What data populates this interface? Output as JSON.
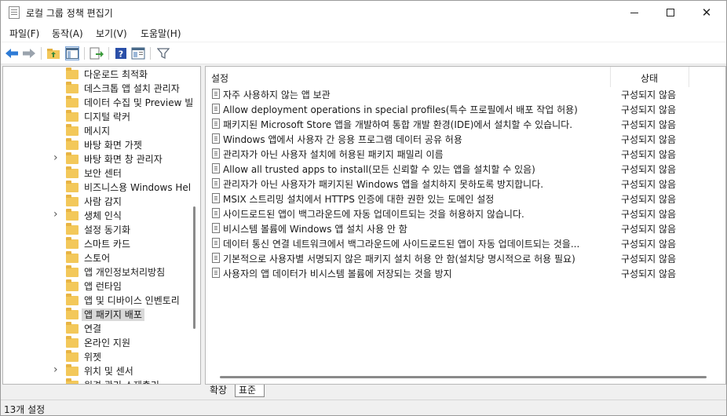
{
  "window": {
    "title": "로컬 그룹 정책 편집기",
    "controls": [
      "minimize",
      "maximize",
      "close"
    ]
  },
  "menu": [
    {
      "label": "파일(F)"
    },
    {
      "label": "동작(A)"
    },
    {
      "label": "보기(V)"
    },
    {
      "label": "도움말(H)"
    }
  ],
  "toolbar": {
    "icons": [
      "back-arrow-icon",
      "forward-arrow-icon",
      "up-folder-icon",
      "show-hide-tree-icon",
      "export-list-icon",
      "help-icon",
      "properties-icon",
      "filter-icon"
    ],
    "colors": {
      "arrows": "#2e7bd6",
      "help": "#2a4fa8",
      "filter": "#5f6b7a"
    }
  },
  "tree": {
    "items": [
      {
        "label": "다운로드 최적화",
        "expandable": false
      },
      {
        "label": "데스크톱 앱 설치 관리자",
        "expandable": false
      },
      {
        "label": "데이터 수집 및 Preview 빌",
        "expandable": false
      },
      {
        "label": "디지털 락커",
        "expandable": false
      },
      {
        "label": "메시지",
        "expandable": false
      },
      {
        "label": "바탕 화면 가젯",
        "expandable": false
      },
      {
        "label": "바탕 화면 창 관리자",
        "expandable": true
      },
      {
        "label": "보안 센터",
        "expandable": false
      },
      {
        "label": "비즈니스용 Windows Hel",
        "expandable": false
      },
      {
        "label": "사람 감지",
        "expandable": false
      },
      {
        "label": "생체 인식",
        "expandable": true
      },
      {
        "label": "설정 동기화",
        "expandable": false
      },
      {
        "label": "스마트 카드",
        "expandable": false
      },
      {
        "label": "스토어",
        "expandable": false
      },
      {
        "label": "앱 개인정보처리방침",
        "expandable": false
      },
      {
        "label": "앱 런타임",
        "expandable": false
      },
      {
        "label": "앱 및 디바이스 인벤토리",
        "expandable": false
      },
      {
        "label": "앱 패키지 배포",
        "expandable": false,
        "selected": true
      },
      {
        "label": "연결",
        "expandable": false
      },
      {
        "label": "온라인 지원",
        "expandable": false
      },
      {
        "label": "위젯",
        "expandable": false
      },
      {
        "label": "위치 및 센서",
        "expandable": true
      },
      {
        "label": "원격 관리 소제출리",
        "expandable": false
      }
    ],
    "folder_color": "#f3c85a"
  },
  "list": {
    "columns": {
      "setting": "설정",
      "state": "상태"
    },
    "rows": [
      {
        "name": "자주 사용하지 않는 앱 보관",
        "state": "구성되지 않음"
      },
      {
        "name": "Allow deployment operations in special profiles(특수 프로필에서 배포 작업 허용)",
        "state": "구성되지 않음"
      },
      {
        "name": "패키지된 Microsoft Store 앱을 개발하여 통합 개발 환경(IDE)에서 설치할 수 있습니다.",
        "state": "구성되지 않음"
      },
      {
        "name": "Windows 앱에서 사용자 간 응용 프로그램 데이터 공유 허용",
        "state": "구성되지 않음"
      },
      {
        "name": "관리자가 아닌 사용자 설치에 허용된 패키지 패밀리 이름",
        "state": "구성되지 않음"
      },
      {
        "name": "Allow all trusted apps to install(모든 신뢰할 수 있는 앱을 설치할 수 있음)",
        "state": "구성되지 않음"
      },
      {
        "name": "관리자가 아닌 사용자가 패키지된 Windows 앱을 설치하지 못하도록 방지합니다.",
        "state": "구성되지 않음"
      },
      {
        "name": "MSIX 스트리밍 설치에서 HTTPS 인증에 대한 권한 있는 도메인 설정",
        "state": "구성되지 않음"
      },
      {
        "name": "사이드로드된 앱이 백그라운드에 자동 업데이트되는 것을 허용하지 않습니다.",
        "state": "구성되지 않음"
      },
      {
        "name": "비시스템 볼륨에 Windows 앱 설치 사용 안 함",
        "state": "구성되지 않음"
      },
      {
        "name": "데이터 통신 연결 네트워크에서 백그라운드에 사이드로드된 앱이 자동 업데이트되는 것을...",
        "state": "구성되지 않음"
      },
      {
        "name": "기본적으로 사용자별 서명되지 않은 패키지 설치 허용 안 함(설치당 명시적으로 허용 필요)",
        "state": "구성되지 않음"
      },
      {
        "name": "사용자의 앱 데이터가 비시스템 볼륨에 저장되는 것을 방지",
        "state": "구성되지 않음"
      }
    ]
  },
  "tabs": [
    {
      "label": "확장"
    },
    {
      "label": "표준",
      "active": true
    }
  ],
  "status": {
    "text": "13개 설정"
  }
}
